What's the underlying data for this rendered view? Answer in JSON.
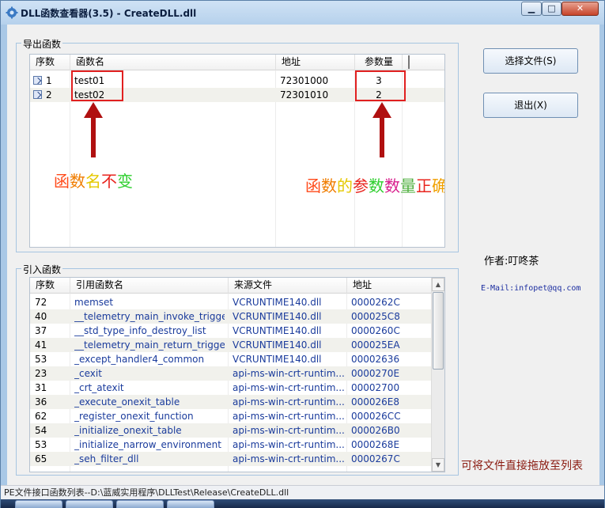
{
  "window": {
    "title": "DLL函数查看器(3.5)  - CreateDLL.dll",
    "controls": {
      "minimize": "▁",
      "maximize": "□",
      "close": "✕"
    }
  },
  "export_group": {
    "title": "导出函数",
    "columns": [
      "序数",
      "函数名",
      "地址",
      "参数量"
    ],
    "rows": [
      {
        "ordinal": "1",
        "name": "test01",
        "address": "72301000",
        "params": "3"
      },
      {
        "ordinal": "2",
        "name": "test02",
        "address": "72301010",
        "params": "2"
      }
    ]
  },
  "annotations": {
    "name_note": [
      "函",
      "数",
      "名",
      "不",
      "变"
    ],
    "param_note": [
      "函",
      "数",
      "的",
      "参",
      "数",
      "数",
      "量",
      "正",
      "确"
    ],
    "name_colors": [
      "#ff4a1a",
      "#f07d00",
      "#e5c800",
      "#e8241e",
      "#2fcf2f"
    ],
    "param_colors": [
      "#ff4a1a",
      "#f07d00",
      "#e5c800",
      "#e8241e",
      "#2fcf2f",
      "#d81e8c",
      "#50b040",
      "#e8241e",
      "#f0a000"
    ],
    "arrow_color": "#b01010"
  },
  "import_group": {
    "title": "引入函数",
    "columns": [
      "序数",
      "引用函数名",
      "来源文件",
      "地址"
    ],
    "rows": [
      {
        "ordinal": "72",
        "name": "memset",
        "source": "VCRUNTIME140.dll",
        "address": "0000262C"
      },
      {
        "ordinal": "40",
        "name": "__telemetry_main_invoke_trigger",
        "source": "VCRUNTIME140.dll",
        "address": "000025C8"
      },
      {
        "ordinal": "37",
        "name": "__std_type_info_destroy_list",
        "source": "VCRUNTIME140.dll",
        "address": "0000260C"
      },
      {
        "ordinal": "41",
        "name": "__telemetry_main_return_trigger",
        "source": "VCRUNTIME140.dll",
        "address": "000025EA"
      },
      {
        "ordinal": "53",
        "name": "_except_handler4_common",
        "source": "VCRUNTIME140.dll",
        "address": "00002636"
      },
      {
        "ordinal": "23",
        "name": "_cexit",
        "source": "api-ms-win-crt-runtim...",
        "address": "0000270E"
      },
      {
        "ordinal": "31",
        "name": "_crt_atexit",
        "source": "api-ms-win-crt-runtim...",
        "address": "00002700"
      },
      {
        "ordinal": "36",
        "name": "_execute_onexit_table",
        "source": "api-ms-win-crt-runtim...",
        "address": "000026E8"
      },
      {
        "ordinal": "62",
        "name": "_register_onexit_function",
        "source": "api-ms-win-crt-runtim...",
        "address": "000026CC"
      },
      {
        "ordinal": "54",
        "name": "_initialize_onexit_table",
        "source": "api-ms-win-crt-runtim...",
        "address": "000026B0"
      },
      {
        "ordinal": "53",
        "name": "_initialize_narrow_environment",
        "source": "api-ms-win-crt-runtim...",
        "address": "0000268E"
      },
      {
        "ordinal": "65",
        "name": "_seh_filter_dll",
        "source": "api-ms-win-crt-runtim...",
        "address": "0000267C"
      }
    ]
  },
  "buttons": {
    "open_file": "选择文件(S)",
    "exit": "退出(X)"
  },
  "author": "作者:叮咚茶",
  "email": "E-Mail:infopet@qq.com",
  "drop_tip": "可将文件直接拖放至列表",
  "status": "PE文件接口函数列表--D:\\蓝威实用程序\\DLLTest\\Release\\CreateDLL.dll",
  "scrollbar": {
    "up": "▲",
    "down": "▼"
  }
}
